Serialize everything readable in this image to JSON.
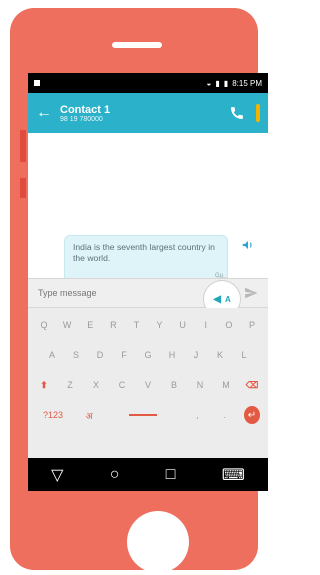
{
  "status_bar": {
    "time": "8:15 PM"
  },
  "app_bar": {
    "contact_name": "Contact 1",
    "contact_number": "98 19 780000"
  },
  "chat": {
    "message_text": "India is the seventh largest country in the world.",
    "message_meta": "Gu"
  },
  "composer": {
    "placeholder": "Type message"
  },
  "keyboard": {
    "row1": [
      "Q",
      "W",
      "E",
      "R",
      "T",
      "Y",
      "U",
      "I",
      "O",
      "P"
    ],
    "row2": [
      "A",
      "S",
      "D",
      "F",
      "G",
      "H",
      "J",
      "K",
      "L"
    ],
    "row3": [
      "Z",
      "X",
      "C",
      "V",
      "B",
      "N",
      "M"
    ],
    "bottom_left": "?123",
    "lang_key": "अ"
  },
  "colors": {
    "phone_body": "#ef6f5e",
    "appbar": "#2bb1c9",
    "accent": "#e35a44",
    "overflow_menu": "#f0b400"
  },
  "icons": [
    "back-arrow-icon",
    "call-icon",
    "overflow-menu-icon",
    "speaker-icon",
    "mic-icon",
    "send-icon",
    "shift-icon",
    "backspace-icon",
    "enter-icon",
    "nav-back-icon",
    "nav-home-icon",
    "nav-recents-icon"
  ]
}
